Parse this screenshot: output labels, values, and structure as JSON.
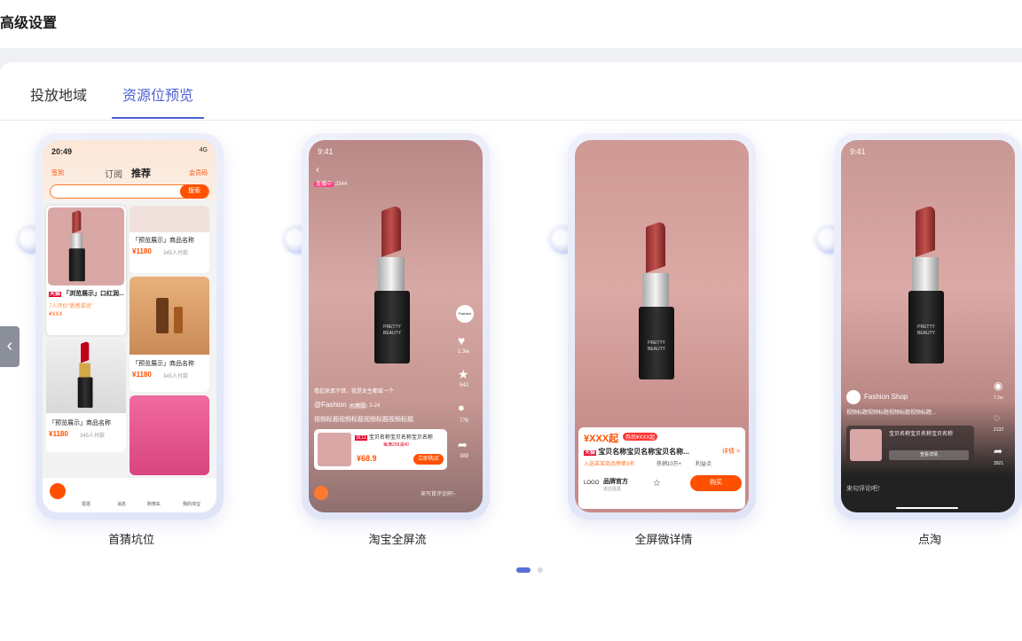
{
  "page": {
    "title": "高级设置"
  },
  "tabs": [
    {
      "label": "投放地域",
      "active": false
    },
    {
      "label": "资源位预览",
      "active": true
    }
  ],
  "cards": [
    {
      "caption": "首猜坑位",
      "time": "20:49",
      "signal": "4G",
      "nav_left": "签到",
      "nav_mid1": "订阅",
      "nav_mid2": "推荐",
      "nav_right": "会员码",
      "search_btn": "搜索",
      "item1_title": "「浏览展示」口红润...",
      "item1_sub": "7人评价\"质感滋润\"",
      "item1_price": "¥XXX",
      "item2_title": "「预览展示」商品名称",
      "item2_price": "¥1180",
      "item2_sold": "345人付款",
      "item3_title": "「预览展示」商品名称",
      "item3_price": "¥1180",
      "item3_sold": "345人付款",
      "item4_title": "「预览展示」商品名称",
      "item4_price": "¥1180",
      "item4_sold": "345人付款",
      "tabbar": [
        "首页",
        "逛逛",
        "消息",
        "购物车",
        "我的淘宝"
      ],
      "badge_tm": "天猫"
    },
    {
      "caption": "淘宝全屏流",
      "time": "9:41",
      "live_tag": "直播中",
      "live_count": "2344",
      "account": "@Fashion",
      "follow": "+ 关注",
      "date": "3-24",
      "desc": "视频标题视频标题视频标题视频标题",
      "comment_hint": "看起来真不错，我是女生都爱一个",
      "likes": "1.3w",
      "stars": "542",
      "comments": "778",
      "shares": "389",
      "product_title": "宝贝名称宝贝名称宝贝名称",
      "product_badge": "双11",
      "product_coupon": "每满299减40",
      "product_price": "¥68.9",
      "product_btn": "立即购买",
      "input_hint": "来写首评论吧~"
    },
    {
      "caption": "全屏微详情",
      "price": "¥XXX起",
      "coupon": "券后¥XXX起",
      "title": "宝贝名称宝贝名称宝贝名称...",
      "detail": "详情 >",
      "rank": "入选某某商品榜第3名",
      "sales": "热销10万+",
      "benefit": "利益点",
      "brand": "品牌官方",
      "brand_sub": "进店逛逛",
      "logo": "LOGO",
      "buy": "购买",
      "badge_tm": "天猫"
    },
    {
      "caption": "点淘",
      "time": "9:41",
      "shop": "Fashion Shop",
      "desc": "视频标题视频标题视频标题视频标题...",
      "likes": "7.2w",
      "comments": "2132",
      "shares": "3921",
      "product_title": "宝贝名称宝贝名称宝贝名称",
      "product_btn": "查看详情",
      "comment_input": "来句评论吧！"
    }
  ],
  "colors": {
    "accent": "#4a5fd6",
    "taobao_orange": "#ff5000",
    "tm_red": "#e4002b"
  },
  "pager": {
    "total": 2,
    "current": 1
  }
}
